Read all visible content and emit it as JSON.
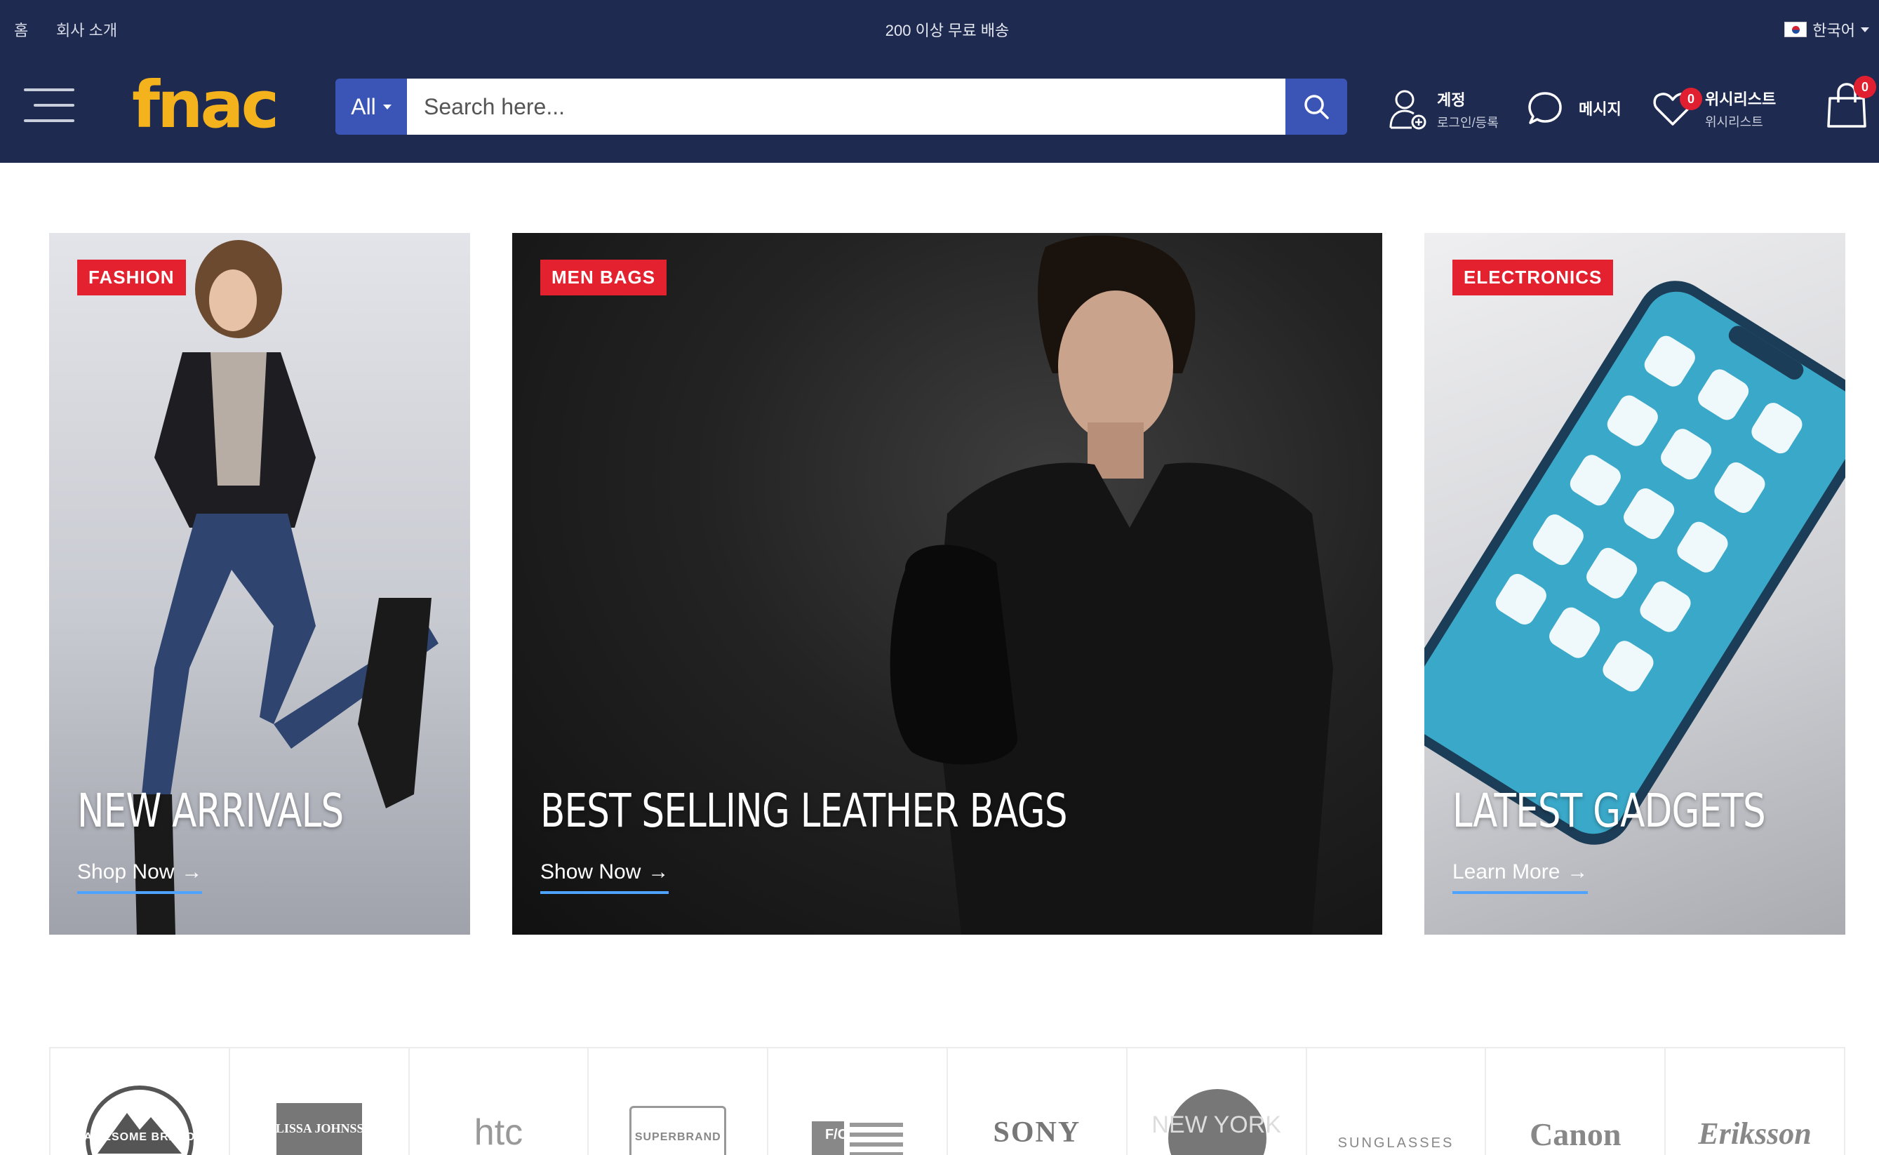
{
  "topbar": {
    "home": "홈",
    "about": "회사 소개",
    "promo": "200 이상 무료 배송",
    "language": "한국어"
  },
  "logo": "fnac",
  "search": {
    "category": "All",
    "placeholder": "Search here..."
  },
  "account": {
    "title": "계정",
    "subtitle": "로그인/등록"
  },
  "messages": {
    "label": "메시지"
  },
  "wishlist": {
    "title": "위시리스트",
    "subtitle": "위시리스트",
    "count": "0"
  },
  "cart": {
    "count": "0"
  },
  "banners": [
    {
      "tag": "FASHION",
      "title": "NEW ARRIVALS",
      "cta": "Shop Now"
    },
    {
      "tag": "MEN BAGS",
      "title": "BEST SELLING LEATHER BAGS",
      "cta": "Show Now"
    },
    {
      "tag": "ELECTRONICS",
      "title": "LATEST GADGETS",
      "cta": "Learn More"
    }
  ],
  "brands": [
    "AWESOME BRAND",
    "MELISSA JOHNSSON",
    "htc",
    "SUPERBRAND",
    "F/C",
    "SONY",
    "NEW YORK",
    "SUNGLASSES",
    "Canon",
    "Eriksson"
  ],
  "colors": {
    "header_bg": "#1e2a4f",
    "logo": "#f4b21c",
    "accent_blue": "#3a55b6",
    "tag_red": "#e3212f",
    "cta_underline": "#4da3ff"
  }
}
